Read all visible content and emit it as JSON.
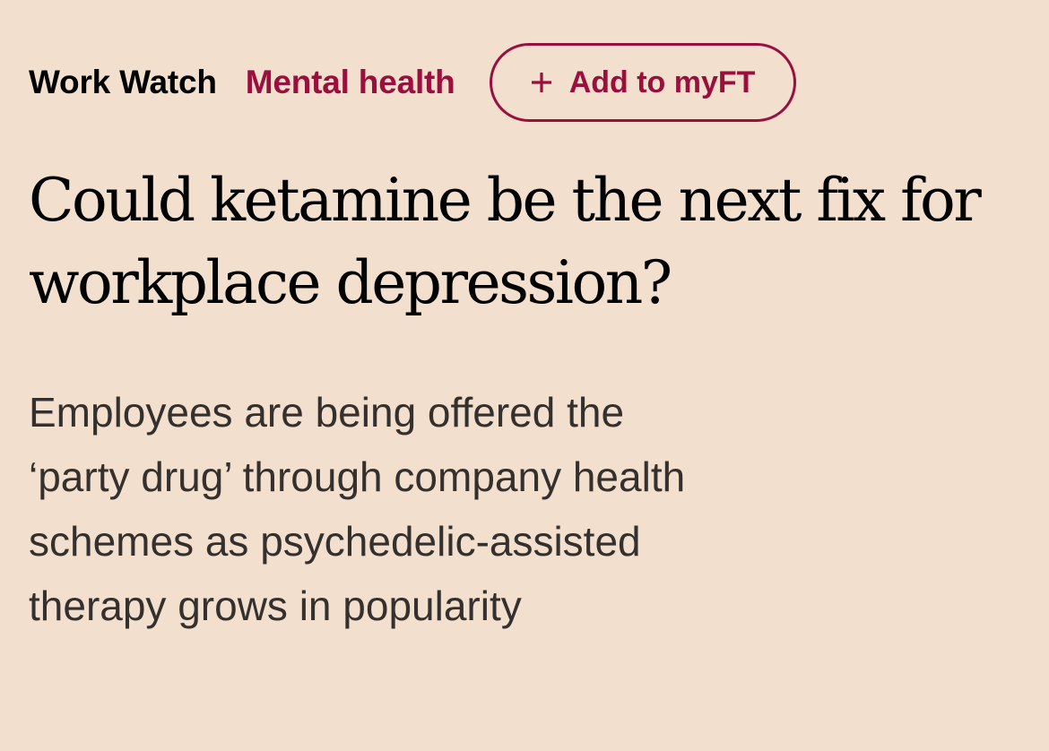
{
  "article": {
    "series": "Work Watch",
    "topic": "Mental health",
    "myft_button": {
      "label": "Add to myFT",
      "icon": "plus-icon"
    },
    "headline": "Could ketamine be the next fix for workplace depression?",
    "standfirst": "Employees are being offered the ‘party drug’ through company health schemes as psychedelic-assisted therapy grows in popularity"
  },
  "colors": {
    "background": "#f2dfce",
    "accent": "#990f3d",
    "headline_text": "#000000",
    "body_text": "#33302e"
  }
}
